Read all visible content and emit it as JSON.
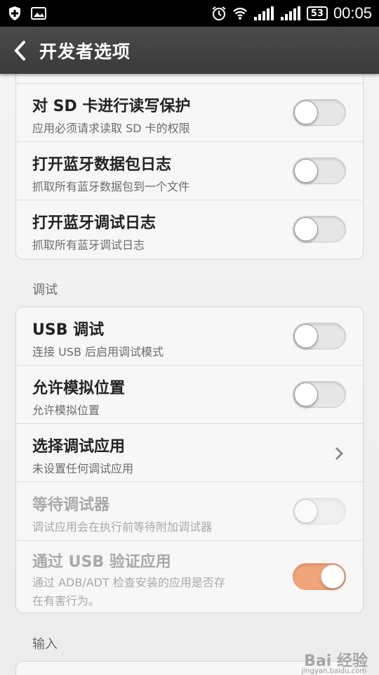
{
  "status_bar": {
    "battery": "53",
    "time": "00:05"
  },
  "header": {
    "title": "开发者选项"
  },
  "cards": {
    "storage": {
      "rows": [
        {
          "title": "对 SD 卡进行读写保护",
          "subtitle": "应用必须请求读取 SD 卡的权限",
          "toggle_on": false
        },
        {
          "title": "打开蓝牙数据包日志",
          "subtitle": "抓取所有蓝牙数据包到一个文件",
          "toggle_on": false
        },
        {
          "title": "打开蓝牙调试日志",
          "subtitle": "抓取所有蓝牙调试日志",
          "toggle_on": false
        }
      ]
    },
    "debug": {
      "label": "调试",
      "rows": [
        {
          "title": "USB 调试",
          "subtitle": "连接 USB 后启用调试模式",
          "toggle_on": false
        },
        {
          "title": "允许模拟位置",
          "subtitle": "允许模拟位置",
          "toggle_on": false
        },
        {
          "title": "选择调试应用",
          "subtitle": "未设置任何调试应用"
        },
        {
          "title": "等待调试器",
          "subtitle": "调试应用会在执行前等待附加调试器",
          "toggle_on": false,
          "enabled": false
        },
        {
          "title": "通过 USB 验证应用",
          "subtitle_line1": "通过 ADB/ADT 检查安装的应用是否存",
          "subtitle_line2": "在有害行为。",
          "toggle_on": true,
          "enabled": false
        }
      ]
    },
    "input": {
      "label": "输入"
    }
  },
  "watermark": {
    "text": "Bai 经验",
    "url": "jingyan.baidu.com"
  },
  "colors": {
    "toggle_on": "#f2a47a",
    "titlebar": "#3f3f3f"
  }
}
